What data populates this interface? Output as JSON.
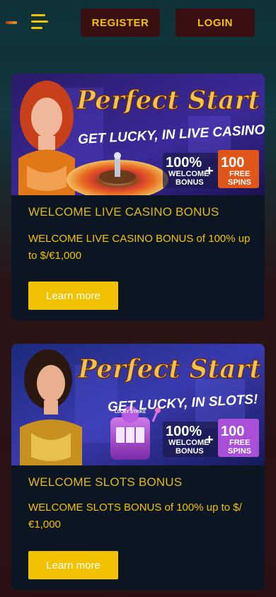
{
  "header": {
    "register_label": "REGISTER",
    "login_label": "LOGIN",
    "menu_icon": "hamburger-menu-icon",
    "accent": "#f2c200"
  },
  "promotions": [
    {
      "banner": {
        "title": "Perfect Start",
        "subtitle": "GET LUCKY, IN LIVE CASINO!",
        "bonus_percent": "100%",
        "bonus_percent_label_1": "WELCOME",
        "bonus_percent_label_2": "BONUS",
        "plus": "+",
        "spins_count": "100",
        "spins_label_1": "FREE",
        "spins_label_2": "SPINS",
        "theme_color": "#e0551a"
      },
      "title": "WELCOME LIVE CASINO BONUS",
      "description": "WELCOME LIVE CASINO BONUS of 100% up to $/€1,000",
      "button_label": "Learn more"
    },
    {
      "banner": {
        "title": "Perfect Start",
        "subtitle": "GET LUCKY, IN SLOTS!",
        "bonus_percent": "100%",
        "bonus_percent_label_1": "WELCOME",
        "bonus_percent_label_2": "BONUS",
        "plus": "+",
        "spins_count": "100",
        "spins_label_1": "FREE",
        "spins_label_2": "SPINS",
        "slot_label": "LUCKY STRIKE",
        "theme_color": "#a94fd8"
      },
      "title": "WELCOME SLOTS BONUS",
      "description": "WELCOME SLOTS BONUS of 100% up to $/€1,000",
      "button_label": "Learn more"
    }
  ]
}
